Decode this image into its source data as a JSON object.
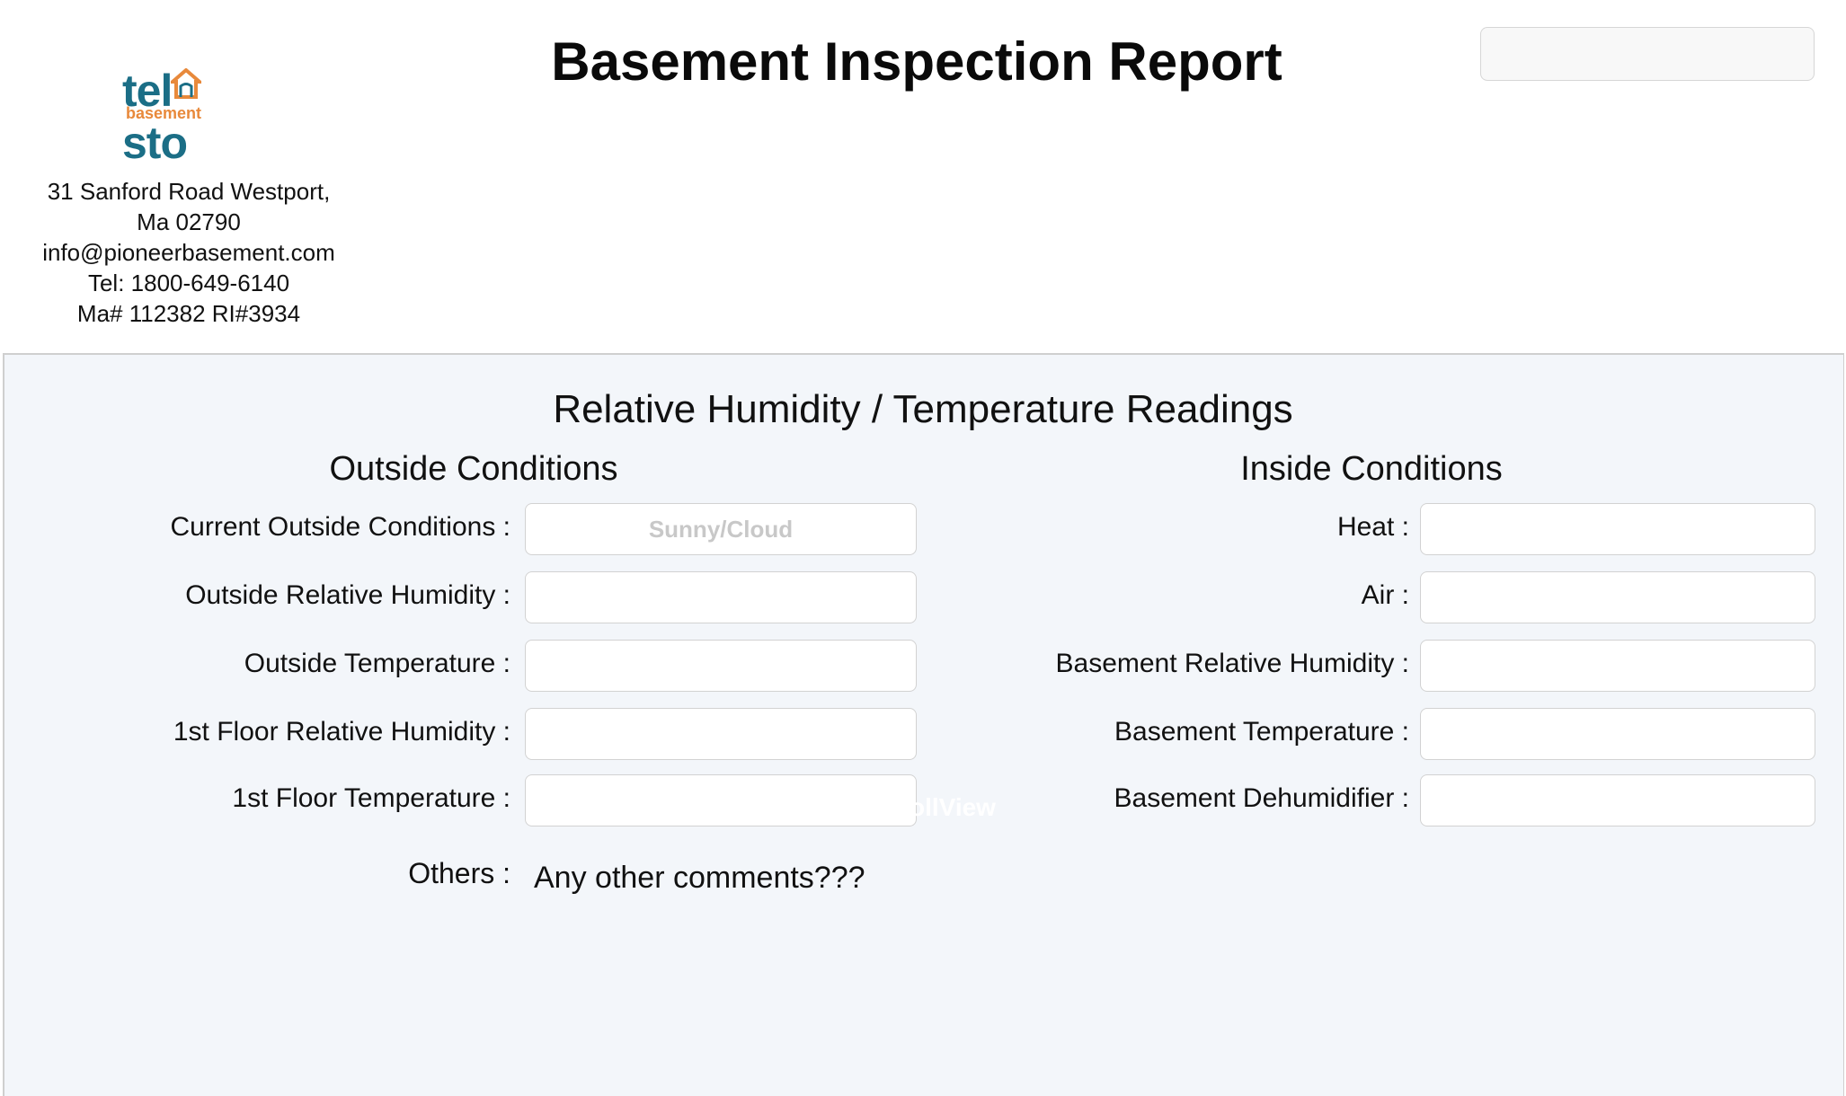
{
  "header": {
    "logo": {
      "wordmark": "telwsto",
      "subtitle": "basement"
    },
    "address_lines": [
      "31 Sanford Road Westport,",
      "Ma 02790",
      "info@pioneerbasement.com",
      "Tel: 1800-649-6140",
      "Ma# 112382 RI#3934"
    ],
    "title": "Basement Inspection Report",
    "top_field_value": ""
  },
  "section": {
    "title": "Relative Humidity / Temperature Readings",
    "outside": {
      "title": "Outside Conditions",
      "fields": [
        {
          "label": "Current Outside Conditions :",
          "value": "",
          "placeholder": "Sunny/Cloud"
        },
        {
          "label": "Outside Relative Humidity :",
          "value": "",
          "placeholder": ""
        },
        {
          "label": "Outside Temperature :",
          "value": "",
          "placeholder": ""
        },
        {
          "label": "1st Floor Relative Humidity :",
          "value": "",
          "placeholder": ""
        },
        {
          "label": "1st Floor Temperature :",
          "value": "",
          "placeholder": ""
        }
      ]
    },
    "inside": {
      "title": "Inside Conditions",
      "fields": [
        {
          "label": "Heat :",
          "value": ""
        },
        {
          "label": "Air :",
          "value": ""
        },
        {
          "label": "Basement Relative Humidity :",
          "value": ""
        },
        {
          "label": "Basement Temperature :",
          "value": ""
        },
        {
          "label": "Basement Dehumidifier :",
          "value": ""
        }
      ]
    },
    "ghost_text": "ollView",
    "others": {
      "label": "Others :",
      "value": "Any other comments???"
    }
  },
  "colors": {
    "logo_primary": "#1b6e86",
    "logo_accent": "#e8893b",
    "panel_bg": "#f3f6fa"
  }
}
